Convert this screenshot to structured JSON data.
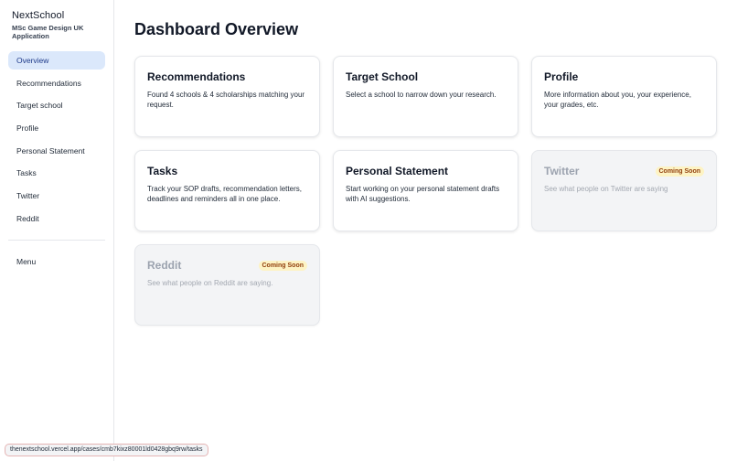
{
  "brand": {
    "name": "NextSchool",
    "subtitle": "MSc Game Design UK Application"
  },
  "sidebar": {
    "items": [
      {
        "label": "Overview",
        "active": true
      },
      {
        "label": "Recommendations"
      },
      {
        "label": "Target school"
      },
      {
        "label": "Profile"
      },
      {
        "label": "Personal Statement"
      },
      {
        "label": "Tasks"
      },
      {
        "label": "Twitter"
      },
      {
        "label": "Reddit"
      }
    ],
    "menu_label": "Menu"
  },
  "main": {
    "title": "Dashboard Overview",
    "cards": [
      {
        "title": "Recommendations",
        "description": "Found 4 schools & 4 scholarships matching your request."
      },
      {
        "title": "Target School",
        "description": "Select a school to narrow down your research."
      },
      {
        "title": "Profile",
        "description": "More information about you, your experience, your grades, etc."
      },
      {
        "title": "Tasks",
        "description": "Track your SOP drafts, recommendation letters, deadlines and reminders all in one place."
      },
      {
        "title": "Personal Statement",
        "description": "Start working on your personal statement drafts with AI suggestions."
      },
      {
        "title": "Twitter",
        "description": "See what people on Twitter are saying",
        "badge": "Coming Soon"
      },
      {
        "title": "Reddit",
        "description": "See what people on Reddit are saying.",
        "badge": "Coming Soon"
      }
    ]
  },
  "status_bar": {
    "url": "thenextschool.vercel.app/cases/cmb7kixz80001ld0428gbq9rw/tasks"
  },
  "colors": {
    "active_nav_bg": "#dbe8fb",
    "badge_bg": "#fdf3c4",
    "badge_text": "#92400e"
  }
}
